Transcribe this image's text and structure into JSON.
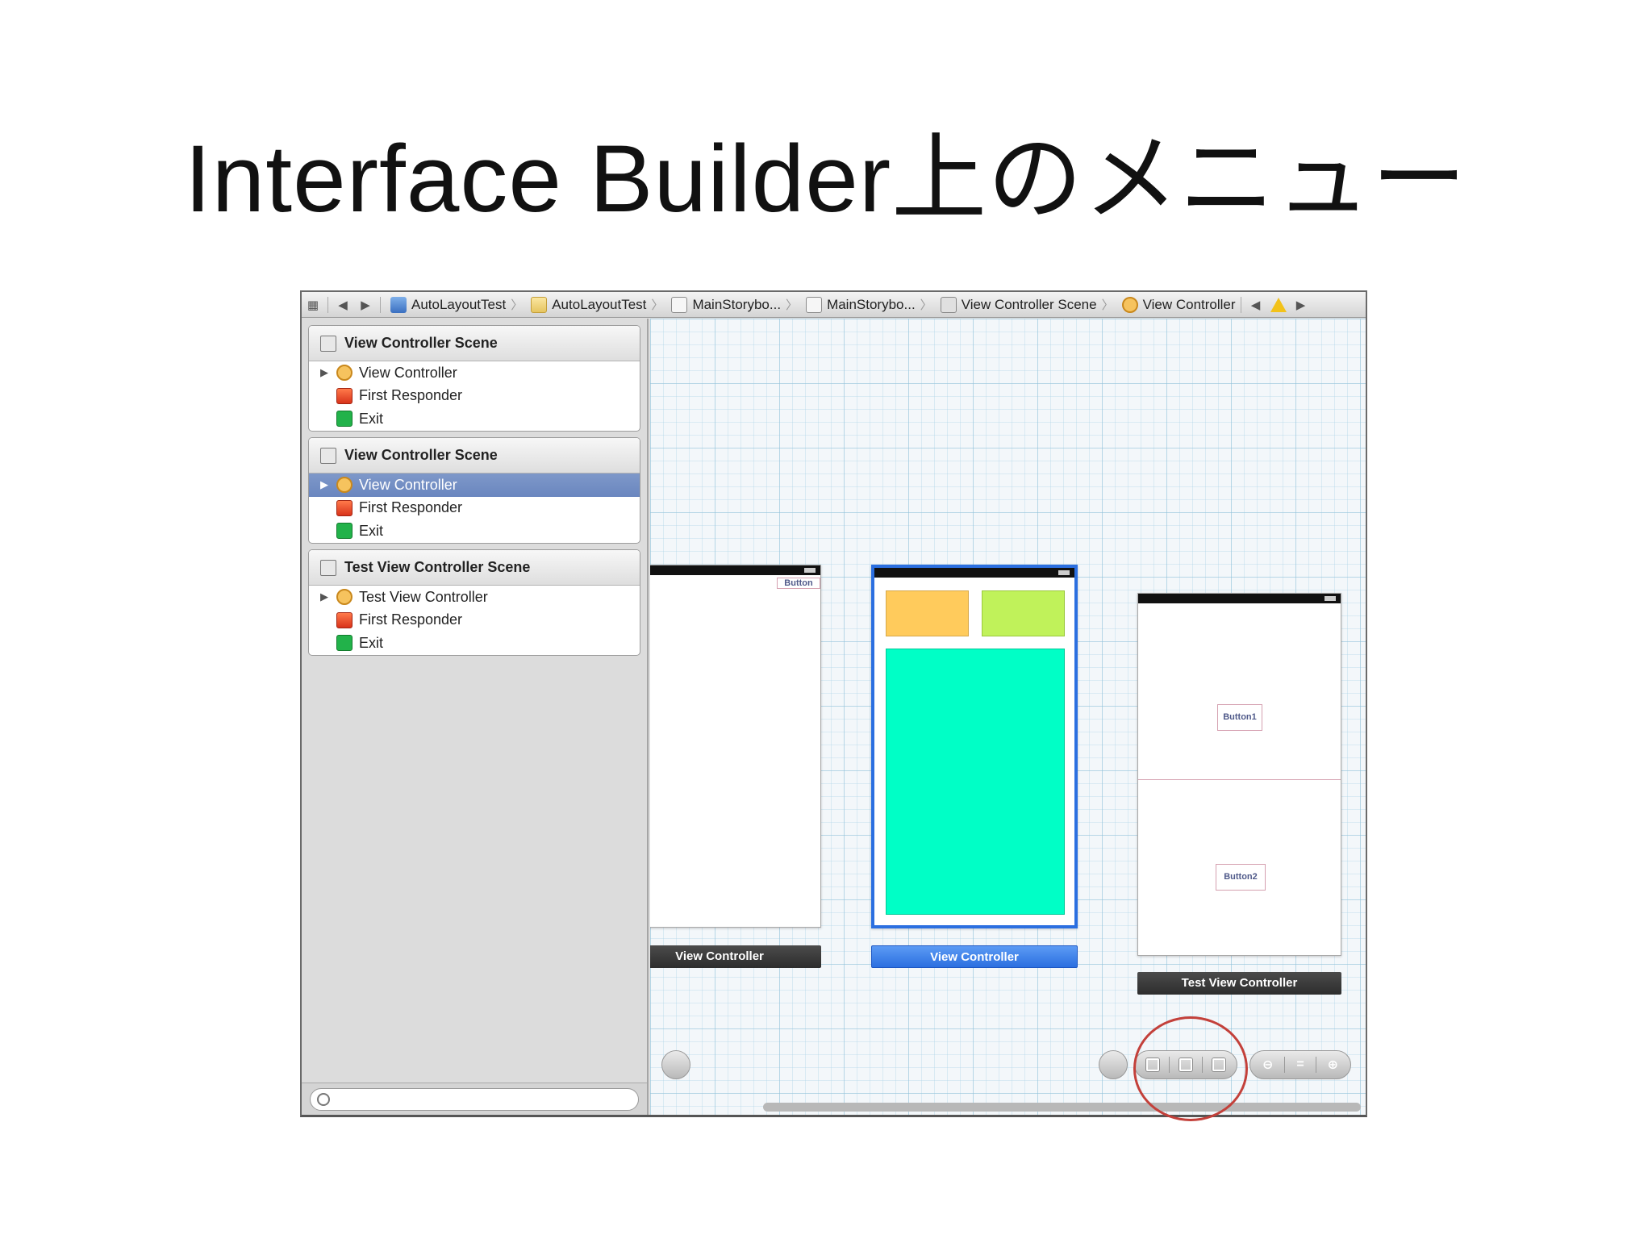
{
  "slide": {
    "title": "Interface Builder上のメニュー"
  },
  "jumpbar": {
    "crumbs": [
      {
        "label": "AutoLayoutTest",
        "icon": "project-icon"
      },
      {
        "label": "AutoLayoutTest",
        "icon": "folder-icon"
      },
      {
        "label": "MainStorybo...",
        "icon": "storyboard-icon"
      },
      {
        "label": "MainStorybo...",
        "icon": "storyboard-icon"
      },
      {
        "label": "View Controller Scene",
        "icon": "scene-icon"
      },
      {
        "label": "View Controller",
        "icon": "view-controller-icon"
      }
    ]
  },
  "outline": {
    "scenes": [
      {
        "title": "View Controller Scene",
        "items": [
          "View Controller",
          "First Responder",
          "Exit"
        ]
      },
      {
        "title": "View Controller Scene",
        "items": [
          "View Controller",
          "First Responder",
          "Exit"
        ],
        "selected_item": "View Controller"
      },
      {
        "title": "Test View Controller Scene",
        "items": [
          "Test View Controller",
          "First Responder",
          "Exit"
        ]
      }
    ]
  },
  "canvas": {
    "scene1": {
      "label": "View Controller",
      "button": "Button"
    },
    "scene2": {
      "label": "View Controller",
      "colors": {
        "orange": "#ffcb5c",
        "lime": "#c0f25a",
        "cyan": "#00ffc6"
      }
    },
    "scene3": {
      "label": "Test View Controller",
      "button1": "Button1",
      "button2": "Button2"
    }
  },
  "colors": {
    "highlight_circle": "#c3403a",
    "selection_blue": "#2b6fe0"
  }
}
